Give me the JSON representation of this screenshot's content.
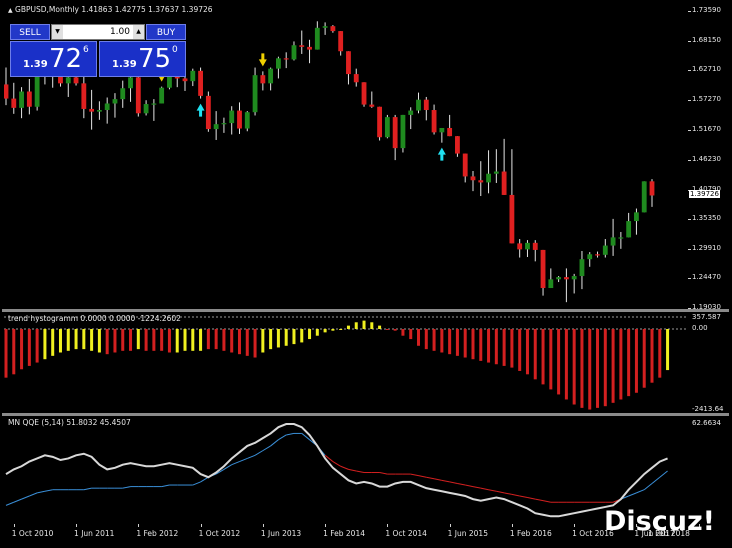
{
  "chart_header": {
    "symbol_line": "GBPUSD,Monthly",
    "ohlc": "1.41863 1.42775 1.37637 1.39726"
  },
  "trade_panel": {
    "sell_label": "SELL",
    "buy_label": "BUY",
    "lot_value": "1.00",
    "lot_down": "▼",
    "lot_up": "▲",
    "sell_quote": {
      "prefix": "1.39",
      "big": "72",
      "sup": "6"
    },
    "buy_quote": {
      "prefix": "1.39",
      "big": "75",
      "sup": "0"
    }
  },
  "price_axis": {
    "labels": [
      "1.73590",
      "1.68150",
      "1.62710",
      "1.57270",
      "1.51670",
      "1.46230",
      "1.40790",
      "1.35350",
      "1.29910",
      "1.24470",
      "1.19030"
    ],
    "current_price": "1.39726"
  },
  "histogram_pane": {
    "title": "trend hystogramm 0.0000 0.0000 -1224.2602",
    "axis_labels": [
      "357.587",
      "0.00",
      "-2413.64"
    ]
  },
  "qqe_pane": {
    "title": "MN  QQE (5,14) 51.8032 45.4507",
    "axis_labels": [
      "62.6634"
    ]
  },
  "time_axis": {
    "labels": [
      "1 Oct 2010",
      "1 Jun 2011",
      "1 Feb 2012",
      "1 Oct 2012",
      "1 Jun 2013",
      "1 Feb 2014",
      "1 Oct 2014",
      "1 Jun 2015",
      "1 Feb 2016",
      "1 Oct 2016",
      "1 Jun 2017",
      "1 Feb 2018"
    ]
  },
  "watermark": "Discuz!",
  "colors": {
    "background": "#000000",
    "bull_candle": "#1f8a1f",
    "bear_candle": "#e02020",
    "hist_bear": "#d42020",
    "hist_bull": "#f0f020",
    "qqe_fast": "#d8d8d8",
    "qqe_slow_up": "#3a8fd8",
    "qqe_slow_down": "#d42020",
    "arrow_down": "#f0d000",
    "arrow_up": "#20e0f0",
    "panel_blue": "#1a30c8"
  },
  "chart_data": [
    {
      "type": "candlestick",
      "title": "GBPUSD,Monthly",
      "x_range": [
        "2010-09",
        "2018-02"
      ],
      "ylim": [
        1.1903,
        1.7359
      ],
      "candles": [
        [
          1.601,
          1.632,
          1.563,
          1.575
        ],
        [
          1.575,
          1.604,
          1.547,
          1.558
        ],
        [
          1.558,
          1.596,
          1.539,
          1.588
        ],
        [
          1.588,
          1.611,
          1.546,
          1.56
        ],
        [
          1.56,
          1.645,
          1.553,
          1.625
        ],
        [
          1.625,
          1.638,
          1.601,
          1.617
        ],
        [
          1.617,
          1.64,
          1.595,
          1.63
        ],
        [
          1.63,
          1.644,
          1.597,
          1.603
        ],
        [
          1.603,
          1.623,
          1.578,
          1.614
        ],
        [
          1.614,
          1.643,
          1.599,
          1.603
        ],
        [
          1.603,
          1.621,
          1.539,
          1.556
        ],
        [
          1.556,
          1.591,
          1.518,
          1.551
        ],
        [
          1.551,
          1.57,
          1.536,
          1.554
        ],
        [
          1.554,
          1.577,
          1.529,
          1.566
        ],
        [
          1.566,
          1.585,
          1.54,
          1.574
        ],
        [
          1.574,
          1.608,
          1.558,
          1.594
        ],
        [
          1.594,
          1.623,
          1.569,
          1.614
        ],
        [
          1.614,
          1.619,
          1.542,
          1.548
        ],
        [
          1.548,
          1.572,
          1.544,
          1.565
        ],
        [
          1.565,
          1.574,
          1.534,
          1.566
        ],
        [
          1.566,
          1.597,
          1.572,
          1.595
        ],
        [
          1.595,
          1.624,
          1.592,
          1.617
        ],
        [
          1.617,
          1.636,
          1.596,
          1.612
        ],
        [
          1.612,
          1.632,
          1.589,
          1.607
        ],
        [
          1.607,
          1.63,
          1.598,
          1.626
        ],
        [
          1.626,
          1.632,
          1.575,
          1.58
        ],
        [
          1.58,
          1.588,
          1.514,
          1.519
        ],
        [
          1.519,
          1.552,
          1.499,
          1.528
        ],
        [
          1.528,
          1.54,
          1.512,
          1.53
        ],
        [
          1.53,
          1.561,
          1.509,
          1.553
        ],
        [
          1.553,
          1.568,
          1.51,
          1.52
        ],
        [
          1.52,
          1.552,
          1.515,
          1.55
        ],
        [
          1.55,
          1.632,
          1.544,
          1.618
        ],
        [
          1.618,
          1.625,
          1.59,
          1.603
        ],
        [
          1.603,
          1.632,
          1.59,
          1.63
        ],
        [
          1.63,
          1.652,
          1.612,
          1.649
        ],
        [
          1.649,
          1.66,
          1.631,
          1.647
        ],
        [
          1.647,
          1.68,
          1.645,
          1.673
        ],
        [
          1.673,
          1.7,
          1.657,
          1.67
        ],
        [
          1.67,
          1.683,
          1.64,
          1.665
        ],
        [
          1.665,
          1.717,
          1.665,
          1.705
        ],
        [
          1.705,
          1.715,
          1.692,
          1.708
        ],
        [
          1.708,
          1.71,
          1.696,
          1.699
        ],
        [
          1.699,
          1.698,
          1.654,
          1.662
        ],
        [
          1.662,
          1.655,
          1.601,
          1.62
        ],
        [
          1.62,
          1.63,
          1.597,
          1.605
        ],
        [
          1.605,
          1.602,
          1.56,
          1.564
        ],
        [
          1.564,
          1.588,
          1.558,
          1.56
        ],
        [
          1.56,
          1.545,
          1.498,
          1.504
        ],
        [
          1.504,
          1.545,
          1.502,
          1.541
        ],
        [
          1.541,
          1.545,
          1.462,
          1.484
        ],
        [
          1.484,
          1.527,
          1.476,
          1.545
        ],
        [
          1.545,
          1.559,
          1.519,
          1.553
        ],
        [
          1.553,
          1.586,
          1.548,
          1.573
        ],
        [
          1.573,
          1.578,
          1.535,
          1.554
        ],
        [
          1.554,
          1.564,
          1.509,
          1.513
        ],
        [
          1.513,
          1.515,
          1.494,
          1.521
        ],
        [
          1.521,
          1.545,
          1.513,
          1.506
        ],
        [
          1.506,
          1.475,
          1.468,
          1.474
        ],
        [
          1.474,
          1.463,
          1.421,
          1.432
        ],
        [
          1.432,
          1.442,
          1.405,
          1.425
        ],
        [
          1.425,
          1.46,
          1.396,
          1.421
        ],
        [
          1.421,
          1.48,
          1.401,
          1.437
        ],
        [
          1.437,
          1.482,
          1.42,
          1.441
        ],
        [
          1.441,
          1.501,
          1.407,
          1.398
        ],
        [
          1.398,
          1.482,
          1.389,
          1.309
        ],
        [
          1.309,
          1.317,
          1.283,
          1.298
        ],
        [
          1.298,
          1.315,
          1.284,
          1.31
        ],
        [
          1.31,
          1.315,
          1.276,
          1.297
        ],
        [
          1.297,
          1.263,
          1.213,
          1.227
        ],
        [
          1.227,
          1.263,
          1.23,
          1.243
        ],
        [
          1.243,
          1.249,
          1.238,
          1.247
        ],
        [
          1.247,
          1.263,
          1.201,
          1.243
        ],
        [
          1.243,
          1.253,
          1.217,
          1.249
        ],
        [
          1.249,
          1.295,
          1.225,
          1.28
        ],
        [
          1.28,
          1.293,
          1.266,
          1.289
        ],
        [
          1.289,
          1.294,
          1.283,
          1.288
        ],
        [
          1.288,
          1.317,
          1.283,
          1.305
        ],
        [
          1.305,
          1.354,
          1.286,
          1.32
        ],
        [
          1.32,
          1.33,
          1.299,
          1.32
        ],
        [
          1.32,
          1.365,
          1.325,
          1.35
        ],
        [
          1.35,
          1.373,
          1.325,
          1.366
        ],
        [
          1.366,
          1.394,
          1.388,
          1.423
        ],
        [
          1.423,
          1.427,
          1.376,
          1.397
        ]
      ],
      "signals": [
        {
          "candle": 20,
          "direction": "down"
        },
        {
          "candle": 25,
          "direction": "up"
        },
        {
          "candle": 33,
          "direction": "down"
        },
        {
          "candle": 56,
          "direction": "up"
        }
      ]
    },
    {
      "type": "bar",
      "title": "trend hystogramm 0.0000 0.0000 -1224.2602",
      "ylim": [
        -2413.64,
        357.587
      ],
      "values": [
        -1450,
        -1350,
        -1200,
        -1100,
        -1000,
        -900,
        -800,
        -700,
        -650,
        -600,
        -600,
        -650,
        -700,
        -750,
        -700,
        -650,
        -650,
        -600,
        -650,
        -650,
        -650,
        -700,
        -700,
        -650,
        -650,
        -650,
        -600,
        -600,
        -650,
        -700,
        -750,
        -800,
        -850,
        -700,
        -600,
        -550,
        -500,
        -450,
        -400,
        -300,
        -200,
        -100,
        -50,
        0,
        100,
        200,
        250,
        200,
        100,
        0,
        -50,
        -200,
        -300,
        -500,
        -600,
        -650,
        -700,
        -750,
        -800,
        -850,
        -900,
        -950,
        -1000,
        -1050,
        -1100,
        -1150,
        -1250,
        -1350,
        -1500,
        -1650,
        -1800,
        -1950,
        -2100,
        -2250,
        -2350,
        -2400,
        -2350,
        -2300,
        -2200,
        -2100,
        -2000,
        -1900,
        -1750,
        -1600,
        -1450,
        -1224
      ],
      "colors": [
        "bear",
        "bear",
        "bear",
        "bear",
        "bear",
        "bull",
        "bull",
        "bull",
        "bull",
        "bull",
        "bull",
        "bull",
        "bull",
        "bear",
        "bear",
        "bear",
        "bear",
        "bull",
        "bear",
        "bear",
        "bear",
        "bear",
        "bull",
        "bull",
        "bull",
        "bull",
        "bear",
        "bear",
        "bear",
        "bear",
        "bear",
        "bear",
        "bear",
        "bull",
        "bull",
        "bull",
        "bull",
        "bull",
        "bull",
        "bull",
        "bull",
        "bull",
        "bull",
        "bull",
        "bull",
        "bull",
        "bull",
        "bull",
        "bull",
        "bear",
        "bear",
        "bear",
        "bear",
        "bear",
        "bear",
        "bear",
        "bear",
        "bear",
        "bear",
        "bear",
        "bear",
        "bear",
        "bear",
        "bear",
        "bear",
        "bear",
        "bear",
        "bear",
        "bear",
        "bear",
        "bear",
        "bear",
        "bear",
        "bear",
        "bear",
        "bear",
        "bear",
        "bear",
        "bear",
        "bear",
        "bear",
        "bear",
        "bear",
        "bear",
        "bear",
        "bull"
      ]
    },
    {
      "type": "line",
      "title": "MN  QQE (5,14) 51.8032 45.4507",
      "ylim": [
        0,
        62.6634
      ],
      "series": [
        {
          "values": [
            30,
            33,
            35,
            38,
            40,
            42,
            41,
            39,
            40,
            42,
            43,
            41,
            36,
            33,
            34,
            36,
            37,
            36,
            35,
            35,
            36,
            37,
            36,
            35,
            34,
            30,
            28,
            31,
            35,
            40,
            44,
            48,
            50,
            53,
            56,
            60,
            62,
            62,
            60,
            55,
            48,
            40,
            34,
            30,
            26,
            24,
            25,
            24,
            22,
            22,
            24,
            25,
            25,
            23,
            21,
            20,
            19,
            18,
            17,
            16,
            14,
            13,
            14,
            15,
            14,
            12,
            10,
            8,
            5,
            4,
            3,
            3,
            4,
            5,
            6,
            7,
            8,
            9,
            10,
            14,
            20,
            25,
            30,
            34,
            38,
            40
          ]
        },
        {
          "values": [
            10,
            12,
            14,
            16,
            18,
            19,
            20,
            20,
            20,
            20,
            20,
            21,
            21,
            21,
            21,
            21,
            22,
            22,
            22,
            22,
            22,
            23,
            23,
            23,
            23,
            25,
            28,
            30,
            33,
            36,
            38,
            40,
            42,
            45,
            48,
            52,
            55,
            56,
            56,
            52,
            48,
            42,
            38,
            35,
            33,
            32,
            31,
            31,
            31,
            30,
            30,
            30,
            30,
            29,
            28,
            27,
            26,
            25,
            24,
            23,
            22,
            21,
            20,
            19,
            18,
            17,
            16,
            15,
            14,
            13,
            12,
            12,
            12,
            12,
            12,
            12,
            12,
            12,
            12,
            14,
            16,
            18,
            20,
            24,
            28,
            32
          ]
        }
      ]
    }
  ]
}
